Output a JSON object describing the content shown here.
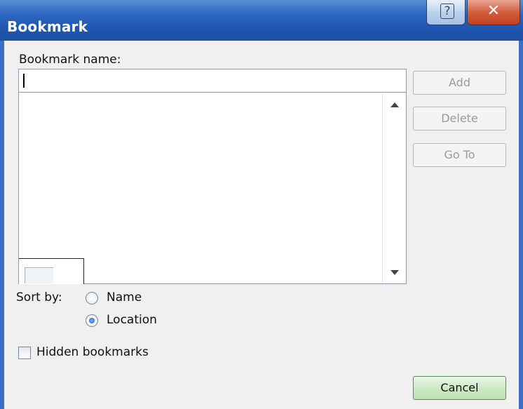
{
  "window": {
    "title": "Bookmark",
    "help_glyph": "?",
    "close_glyph": "✕"
  },
  "bookmark_name": {
    "label": "Bookmark name:",
    "value": ""
  },
  "buttons": {
    "add": "Add",
    "delete": "Delete",
    "goto": "Go To",
    "cancel": "Cancel"
  },
  "sort": {
    "label": "Sort by:",
    "options": [
      {
        "label": "Name",
        "selected": false
      },
      {
        "label": "Location",
        "selected": true
      }
    ]
  },
  "hidden_bookmarks": {
    "label": "Hidden bookmarks",
    "checked": false
  },
  "colors": {
    "titlebar": "#1f56b0",
    "title_text": "#ffffff",
    "close_button": "#d35d3f",
    "cancel_button": "#cfe9c6"
  }
}
